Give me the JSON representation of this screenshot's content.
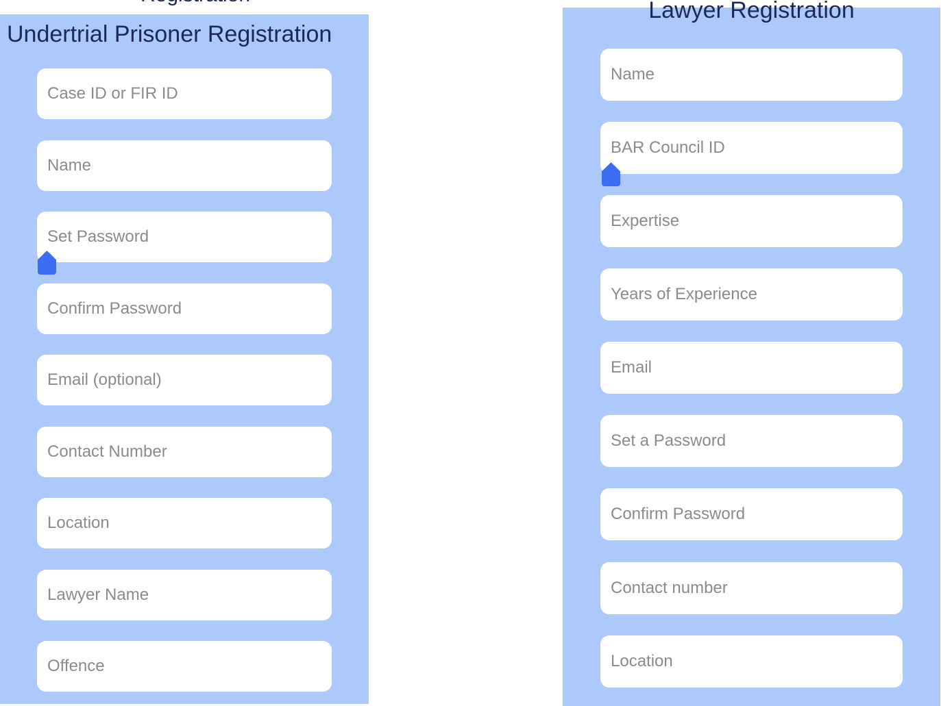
{
  "cutoff_heading": "Registration",
  "prisoner_form": {
    "title": "Undertrial Prisoner Registration",
    "fields": [
      {
        "placeholder": "Case ID or FIR ID"
      },
      {
        "placeholder": "Name"
      },
      {
        "placeholder": "Set Password"
      },
      {
        "placeholder": "Confirm Password"
      },
      {
        "placeholder": "Email (optional)"
      },
      {
        "placeholder": "Contact Number"
      },
      {
        "placeholder": "Location"
      },
      {
        "placeholder": "Lawyer Name"
      },
      {
        "placeholder": "Offence"
      }
    ]
  },
  "lawyer_form": {
    "title": "Lawyer Registration",
    "fields": [
      {
        "placeholder": "Name"
      },
      {
        "placeholder": "BAR Council ID"
      },
      {
        "placeholder": "Expertise"
      },
      {
        "placeholder": "Years of Experience"
      },
      {
        "placeholder": "Email"
      },
      {
        "placeholder": "Set a Password"
      },
      {
        "placeholder": "Confirm Password"
      },
      {
        "placeholder": "Contact number"
      },
      {
        "placeholder": "Location"
      }
    ]
  },
  "colors": {
    "panel_background": "#adc8fb",
    "title_text": "#1b2a55",
    "placeholder_text": "#8b8b8b",
    "cursor_handle": "#3e6df5"
  },
  "icons": {
    "cursor_handle": "text-cursor-handle-icon"
  }
}
